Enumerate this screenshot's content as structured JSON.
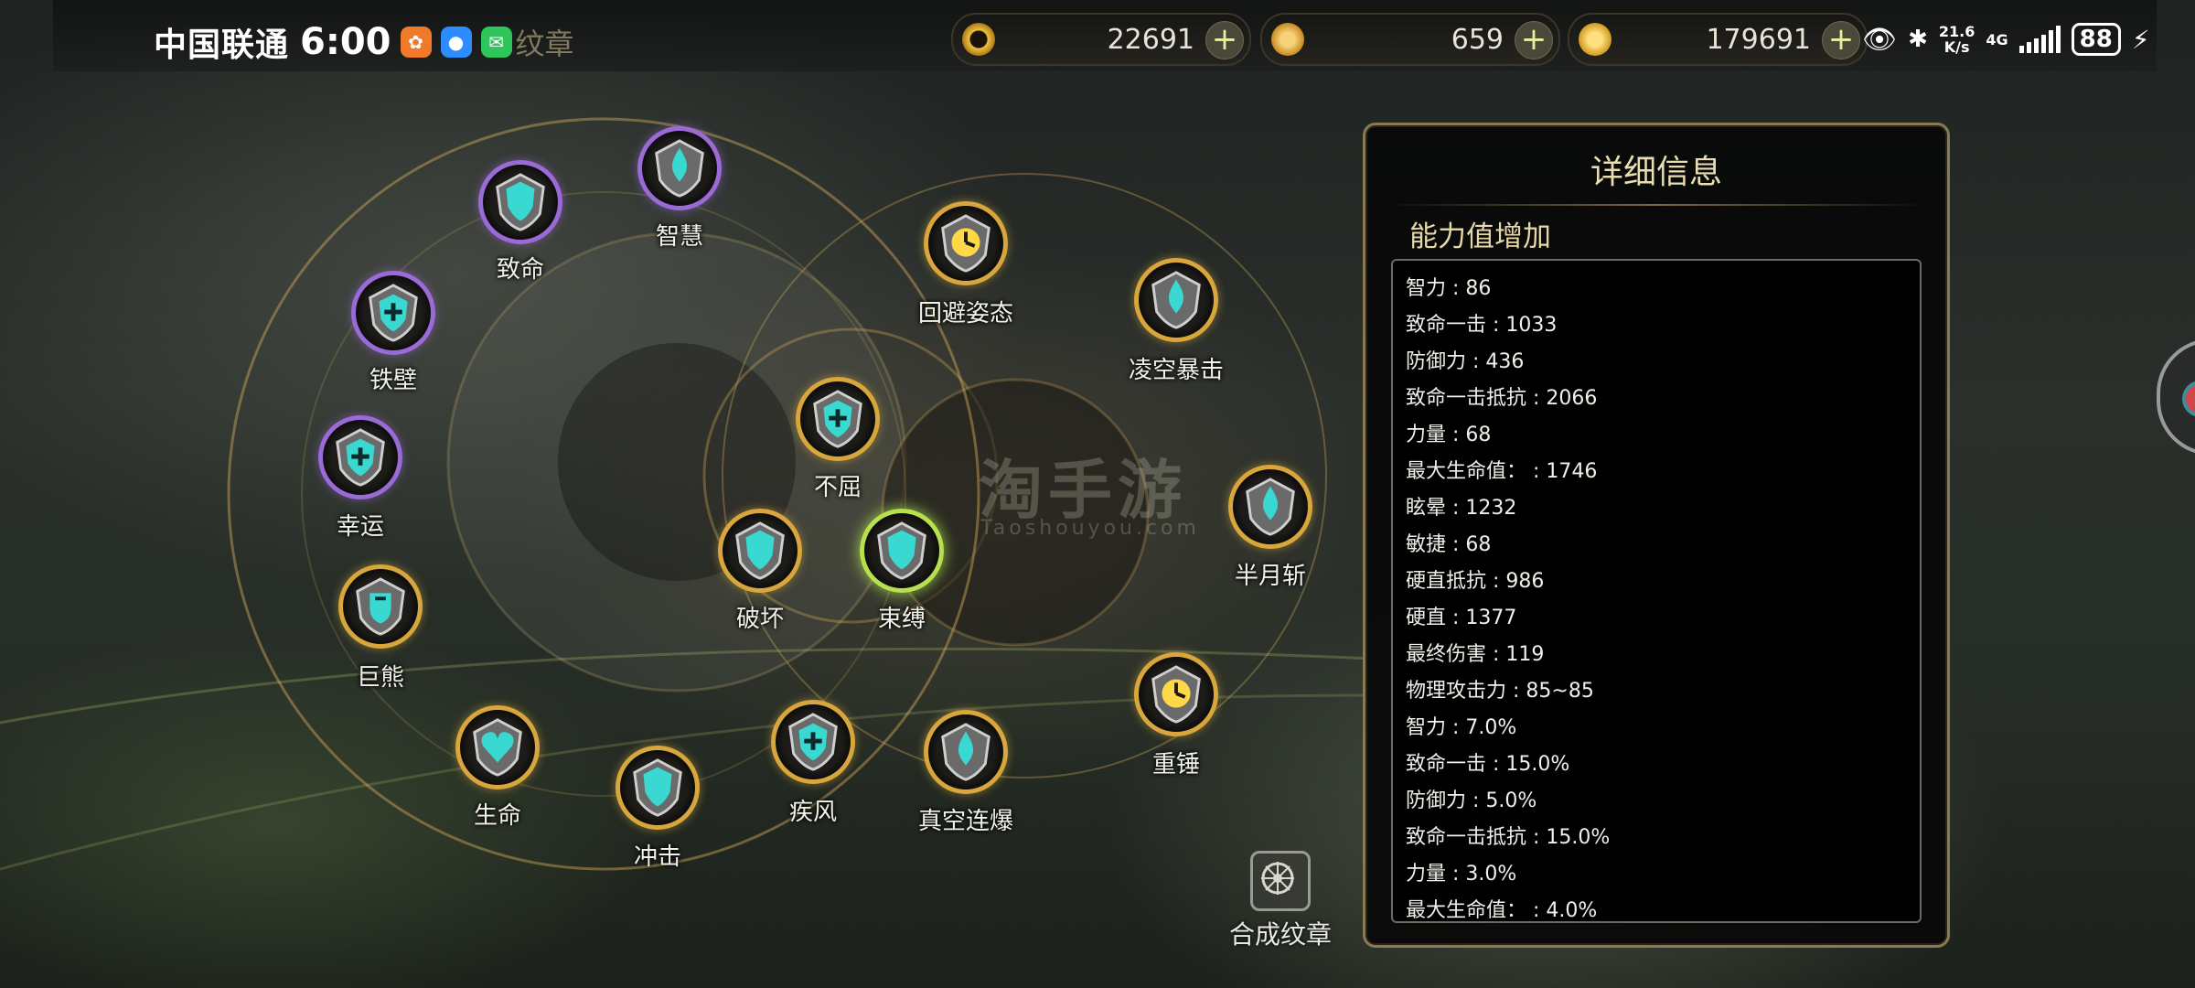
{
  "status_bar": {
    "carrier": "中国联通",
    "time": "6:00",
    "ghost_title": "纹章",
    "network_speed": "21.6",
    "network_unit": "K/s",
    "network_type": "4G",
    "battery": "88"
  },
  "currencies": [
    {
      "value": "22691",
      "color": "#f0c040"
    },
    {
      "value": "659",
      "color": "#e0a830"
    },
    {
      "value": "179691",
      "color": "#f2b830"
    }
  ],
  "nodes": [
    {
      "label": "智慧",
      "style": "purple",
      "glyph": "drop"
    },
    {
      "label": "致命",
      "style": "purple",
      "glyph": "shield"
    },
    {
      "label": "铁壁",
      "style": "purple",
      "glyph": "cross"
    },
    {
      "label": "幸运",
      "style": "purple",
      "glyph": "cross"
    },
    {
      "label": "巨熊",
      "style": "gold",
      "glyph": "fist"
    },
    {
      "label": "生命",
      "style": "gold",
      "glyph": "heart"
    },
    {
      "label": "冲击",
      "style": "gold",
      "glyph": "shield"
    },
    {
      "label": "疾风",
      "style": "gold",
      "glyph": "cross"
    },
    {
      "label": "真空连爆",
      "style": "gold",
      "glyph": "drop"
    },
    {
      "label": "重锤",
      "style": "gold",
      "glyph": "clock"
    },
    {
      "label": "半月斩",
      "style": "gold",
      "glyph": "drop"
    },
    {
      "label": "凌空暴击",
      "style": "gold",
      "glyph": "drop"
    },
    {
      "label": "回避姿态",
      "style": "gold",
      "glyph": "clock"
    },
    {
      "label": "不屈",
      "style": "gold",
      "glyph": "cross"
    },
    {
      "label": "破坏",
      "style": "gold",
      "glyph": "shield"
    },
    {
      "label": "束缚",
      "style": "selected",
      "glyph": "shield"
    }
  ],
  "watermark": {
    "main": "淘手游",
    "sub": "Taoshouyou.com"
  },
  "compose": {
    "label": "合成纹章",
    "icon": "compose-badge-icon"
  },
  "panel": {
    "title": "详细信息",
    "section": "能力值增加",
    "stats": [
      "智力 : 86",
      "致命一击 : 1033",
      "防御力 : 436",
      "致命一击抵抗 : 2066",
      "力量 : 68",
      "最大生命值： : 1746",
      "眩晕 : 1232",
      "敏捷 : 68",
      "硬直抵抗 : 986",
      "硬直 : 1377",
      "最终伤害 : 119",
      "物理攻击力 : 85~85",
      "智力 : 7.0%",
      "致命一击 : 15.0%",
      "防御力 : 5.0%",
      "致命一击抵抗 : 15.0%",
      "力量 : 3.0%",
      "最大生命值： : 4.0%"
    ]
  }
}
